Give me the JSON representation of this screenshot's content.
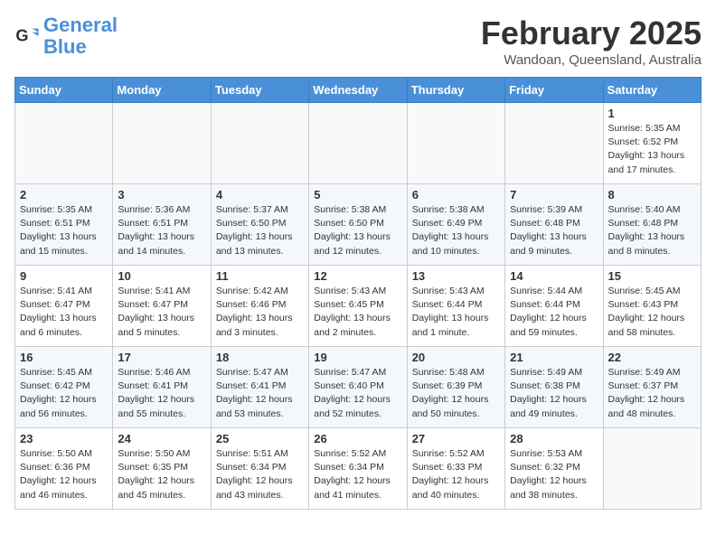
{
  "header": {
    "logo_line1": "General",
    "logo_line2": "Blue",
    "month_title": "February 2025",
    "location": "Wandoan, Queensland, Australia"
  },
  "days_of_week": [
    "Sunday",
    "Monday",
    "Tuesday",
    "Wednesday",
    "Thursday",
    "Friday",
    "Saturday"
  ],
  "weeks": [
    [
      {
        "num": "",
        "info": ""
      },
      {
        "num": "",
        "info": ""
      },
      {
        "num": "",
        "info": ""
      },
      {
        "num": "",
        "info": ""
      },
      {
        "num": "",
        "info": ""
      },
      {
        "num": "",
        "info": ""
      },
      {
        "num": "1",
        "info": "Sunrise: 5:35 AM\nSunset: 6:52 PM\nDaylight: 13 hours\nand 17 minutes."
      }
    ],
    [
      {
        "num": "2",
        "info": "Sunrise: 5:35 AM\nSunset: 6:51 PM\nDaylight: 13 hours\nand 15 minutes."
      },
      {
        "num": "3",
        "info": "Sunrise: 5:36 AM\nSunset: 6:51 PM\nDaylight: 13 hours\nand 14 minutes."
      },
      {
        "num": "4",
        "info": "Sunrise: 5:37 AM\nSunset: 6:50 PM\nDaylight: 13 hours\nand 13 minutes."
      },
      {
        "num": "5",
        "info": "Sunrise: 5:38 AM\nSunset: 6:50 PM\nDaylight: 13 hours\nand 12 minutes."
      },
      {
        "num": "6",
        "info": "Sunrise: 5:38 AM\nSunset: 6:49 PM\nDaylight: 13 hours\nand 10 minutes."
      },
      {
        "num": "7",
        "info": "Sunrise: 5:39 AM\nSunset: 6:48 PM\nDaylight: 13 hours\nand 9 minutes."
      },
      {
        "num": "8",
        "info": "Sunrise: 5:40 AM\nSunset: 6:48 PM\nDaylight: 13 hours\nand 8 minutes."
      }
    ],
    [
      {
        "num": "9",
        "info": "Sunrise: 5:41 AM\nSunset: 6:47 PM\nDaylight: 13 hours\nand 6 minutes."
      },
      {
        "num": "10",
        "info": "Sunrise: 5:41 AM\nSunset: 6:47 PM\nDaylight: 13 hours\nand 5 minutes."
      },
      {
        "num": "11",
        "info": "Sunrise: 5:42 AM\nSunset: 6:46 PM\nDaylight: 13 hours\nand 3 minutes."
      },
      {
        "num": "12",
        "info": "Sunrise: 5:43 AM\nSunset: 6:45 PM\nDaylight: 13 hours\nand 2 minutes."
      },
      {
        "num": "13",
        "info": "Sunrise: 5:43 AM\nSunset: 6:44 PM\nDaylight: 13 hours\nand 1 minute."
      },
      {
        "num": "14",
        "info": "Sunrise: 5:44 AM\nSunset: 6:44 PM\nDaylight: 12 hours\nand 59 minutes."
      },
      {
        "num": "15",
        "info": "Sunrise: 5:45 AM\nSunset: 6:43 PM\nDaylight: 12 hours\nand 58 minutes."
      }
    ],
    [
      {
        "num": "16",
        "info": "Sunrise: 5:45 AM\nSunset: 6:42 PM\nDaylight: 12 hours\nand 56 minutes."
      },
      {
        "num": "17",
        "info": "Sunrise: 5:46 AM\nSunset: 6:41 PM\nDaylight: 12 hours\nand 55 minutes."
      },
      {
        "num": "18",
        "info": "Sunrise: 5:47 AM\nSunset: 6:41 PM\nDaylight: 12 hours\nand 53 minutes."
      },
      {
        "num": "19",
        "info": "Sunrise: 5:47 AM\nSunset: 6:40 PM\nDaylight: 12 hours\nand 52 minutes."
      },
      {
        "num": "20",
        "info": "Sunrise: 5:48 AM\nSunset: 6:39 PM\nDaylight: 12 hours\nand 50 minutes."
      },
      {
        "num": "21",
        "info": "Sunrise: 5:49 AM\nSunset: 6:38 PM\nDaylight: 12 hours\nand 49 minutes."
      },
      {
        "num": "22",
        "info": "Sunrise: 5:49 AM\nSunset: 6:37 PM\nDaylight: 12 hours\nand 48 minutes."
      }
    ],
    [
      {
        "num": "23",
        "info": "Sunrise: 5:50 AM\nSunset: 6:36 PM\nDaylight: 12 hours\nand 46 minutes."
      },
      {
        "num": "24",
        "info": "Sunrise: 5:50 AM\nSunset: 6:35 PM\nDaylight: 12 hours\nand 45 minutes."
      },
      {
        "num": "25",
        "info": "Sunrise: 5:51 AM\nSunset: 6:34 PM\nDaylight: 12 hours\nand 43 minutes."
      },
      {
        "num": "26",
        "info": "Sunrise: 5:52 AM\nSunset: 6:34 PM\nDaylight: 12 hours\nand 41 minutes."
      },
      {
        "num": "27",
        "info": "Sunrise: 5:52 AM\nSunset: 6:33 PM\nDaylight: 12 hours\nand 40 minutes."
      },
      {
        "num": "28",
        "info": "Sunrise: 5:53 AM\nSunset: 6:32 PM\nDaylight: 12 hours\nand 38 minutes."
      },
      {
        "num": "",
        "info": ""
      }
    ]
  ]
}
